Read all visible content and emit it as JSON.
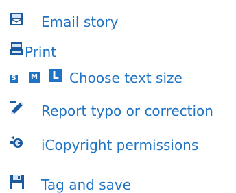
{
  "colors": {
    "link": "#1f73c4",
    "icon_dark": "#1c5a9e",
    "icon_light": "#d7e6f6"
  },
  "tools": {
    "email": {
      "icon": "envelope-icon",
      "label": "Email story"
    },
    "print": {
      "icon": "printer-icon",
      "label": "Print"
    },
    "text_size": {
      "small": "S",
      "medium": "M",
      "large": "L",
      "label": "Choose text size"
    },
    "report": {
      "icon": "pencil-icon",
      "label": "Report typo or correction"
    },
    "copyright": {
      "icon": "icopyright-icon",
      "label": "iCopyright permissions"
    },
    "tag_save": {
      "icon": "floppy-disk-icon",
      "label": "Tag and save"
    }
  }
}
